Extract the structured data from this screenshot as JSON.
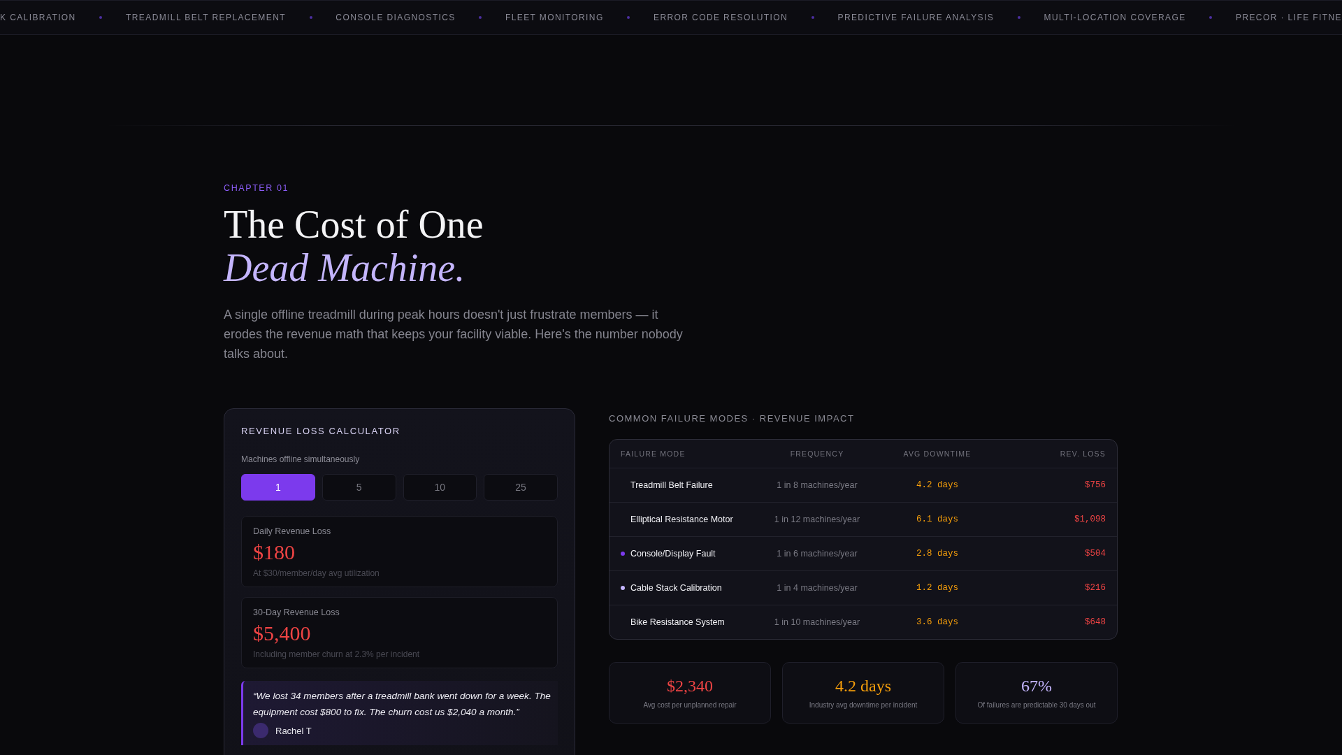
{
  "ticker": [
    "K CALIBRATION",
    "TREADMILL BELT REPLACEMENT",
    "CONSOLE DIAGNOSTICS",
    "FLEET MONITORING",
    "ERROR CODE RESOLUTION",
    "PREDICTIVE FAILURE ANALYSIS",
    "MULTI-LOCATION COVERAGE",
    "PRECOR · LIFE FITNE"
  ],
  "chapter": "CHAPTER 01",
  "title": {
    "line1": "The Cost of One",
    "line2": "Dead Machine."
  },
  "intro": "A single offline treadmill during peak hours doesn't just frustrate members — it erodes the revenue math that keeps your facility viable. Here's the number nobody talks about.",
  "calculator": {
    "title": "REVENUE LOSS CALCULATOR",
    "label": "Machines offline simultaneously",
    "options": [
      {
        "label": "1",
        "selected": true
      },
      {
        "label": "5",
        "selected": false
      },
      {
        "label": "10",
        "selected": false
      },
      {
        "label": "25",
        "selected": false
      }
    ],
    "results": [
      {
        "label": "Daily Revenue Loss",
        "value": "$180",
        "note": "At $30/member/day avg utilization"
      },
      {
        "label": "30-Day Revenue Loss",
        "value": "$5,400",
        "note": "Including member churn at 2.3% per incident"
      }
    ],
    "quote": {
      "text": "“We lost 34 members after a treadmill bank went down for a week. The equipment cost $800 to fix. The churn cost us $2,040 a month.”",
      "author": "Rachel T"
    }
  },
  "failures": {
    "title": "COMMON FAILURE MODES · REVENUE IMPACT",
    "columns": [
      "FAILURE MODE",
      "FREQUENCY",
      "AVG DOWNTIME",
      "REV. LOSS"
    ],
    "rows": [
      {
        "mode": "Treadmill Belt Failure",
        "frequency": "1 in 8 machines/year",
        "downtime": "4.2 days",
        "loss": "$756"
      },
      {
        "mode": "Elliptical Resistance Motor",
        "frequency": "1 in 12 machines/year",
        "downtime": "6.1 days",
        "loss": "$1,098"
      },
      {
        "mode": "Console/Display Fault",
        "frequency": "1 in 6 machines/year",
        "downtime": "2.8 days",
        "loss": "$504",
        "color": "#7c3aed"
      },
      {
        "mode": "Cable Stack Calibration",
        "frequency": "1 in 4 machines/year",
        "downtime": "1.2 days",
        "loss": "$216",
        "color": "#c4b5fd"
      },
      {
        "mode": "Bike Resistance System",
        "frequency": "1 in 10 machines/year",
        "downtime": "3.6 days",
        "loss": "$648"
      }
    ]
  },
  "stats": [
    {
      "value": "$2,340",
      "label": "Avg cost per unplanned repair",
      "kind": "cost"
    },
    {
      "value": "4.2 days",
      "label": "Industry avg downtime per incident",
      "kind": "time"
    },
    {
      "value": "67%",
      "label": "Of failures are predictable 30 days out",
      "kind": "share"
    }
  ]
}
